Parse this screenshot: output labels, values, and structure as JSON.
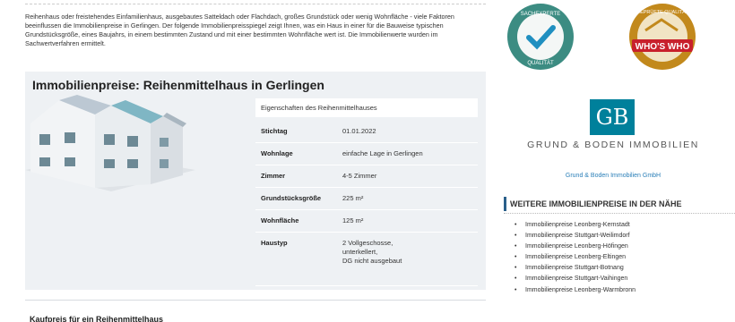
{
  "intro": {
    "text": "Reihenhaus oder freistehendes Einfamilienhaus, ausgebautes Satteldach oder Flachdach, großes Grundstück oder wenig Wohnfläche - viele Faktoren beeinflussen die Immobilienpreise in Gerlingen. Der folgende Immobilienpreisspiegel zeigt Ihnen, was ein Haus in einer für die Bauweise typischen Grundstücksgröße, eines Baujahrs, in einem bestimmten Zustand und mit einer bestimmten Wohnfläche wert ist. Die Immobilienwerte wurden im Sachwertverfahren ermittelt."
  },
  "price_box": {
    "title": "Immobilienpreise: Reihenmittelhaus in Gerlingen",
    "properties_header": "Eigenschaften des Reihenmittelhauses",
    "rows": [
      {
        "label": "Stichtag",
        "value": "01.01.2022"
      },
      {
        "label": "Wohnlage",
        "value": "einfache Lage in Gerlingen"
      },
      {
        "label": "Zimmer",
        "value": "4-5 Zimmer"
      },
      {
        "label": "Grundstücksgröße",
        "value": "225 m²"
      },
      {
        "label": "Wohnfläche",
        "value": "125 m²"
      },
      {
        "label": "Haustyp",
        "value": "2 Vollgeschosse,\nunterkellert,\nDG nicht ausgebaut"
      }
    ]
  },
  "next_heading": "Kaufpreis für ein Reihenmittelhaus",
  "sidebar": {
    "badge_expert": {
      "top_text": "SACHEXPERTE",
      "bottom_text": "QUALITÄT"
    },
    "badge_who": {
      "top_text": "GEPRÜFTE QUALITÄT",
      "label": "WHO'S WHO"
    },
    "logo_letters": "GB",
    "company_name": "GRUND & BODEN IMMOBILIEN",
    "company_link": "Grund & Boden Immobilien GmbH",
    "nearby_heading": "WEITERE IMMOBILIENPREISE IN DER NÄHE",
    "nearby": [
      "Immobilienpreise Leonberg-Kernstadt",
      "Immobilienpreise Stuttgart-Weilimdorf",
      "Immobilienpreise Leonberg-Höfingen",
      "Immobilienpreise Leonberg-Eltingen",
      "Immobilienpreise Stuttgart-Botnang",
      "Immobilienpreise Stuttgart-Vaihingen",
      "Immobilienpreise Leonberg-Warmbronn"
    ]
  },
  "colors": {
    "box_bg": "#eef1f4",
    "brand_teal": "#00809b",
    "expert_badge": "#3c8c82",
    "who_badge": "#c2891c",
    "who_ribbon": "#c8202c",
    "nearby_accent": "#2a5f8a",
    "link": "#2a7fb8"
  }
}
